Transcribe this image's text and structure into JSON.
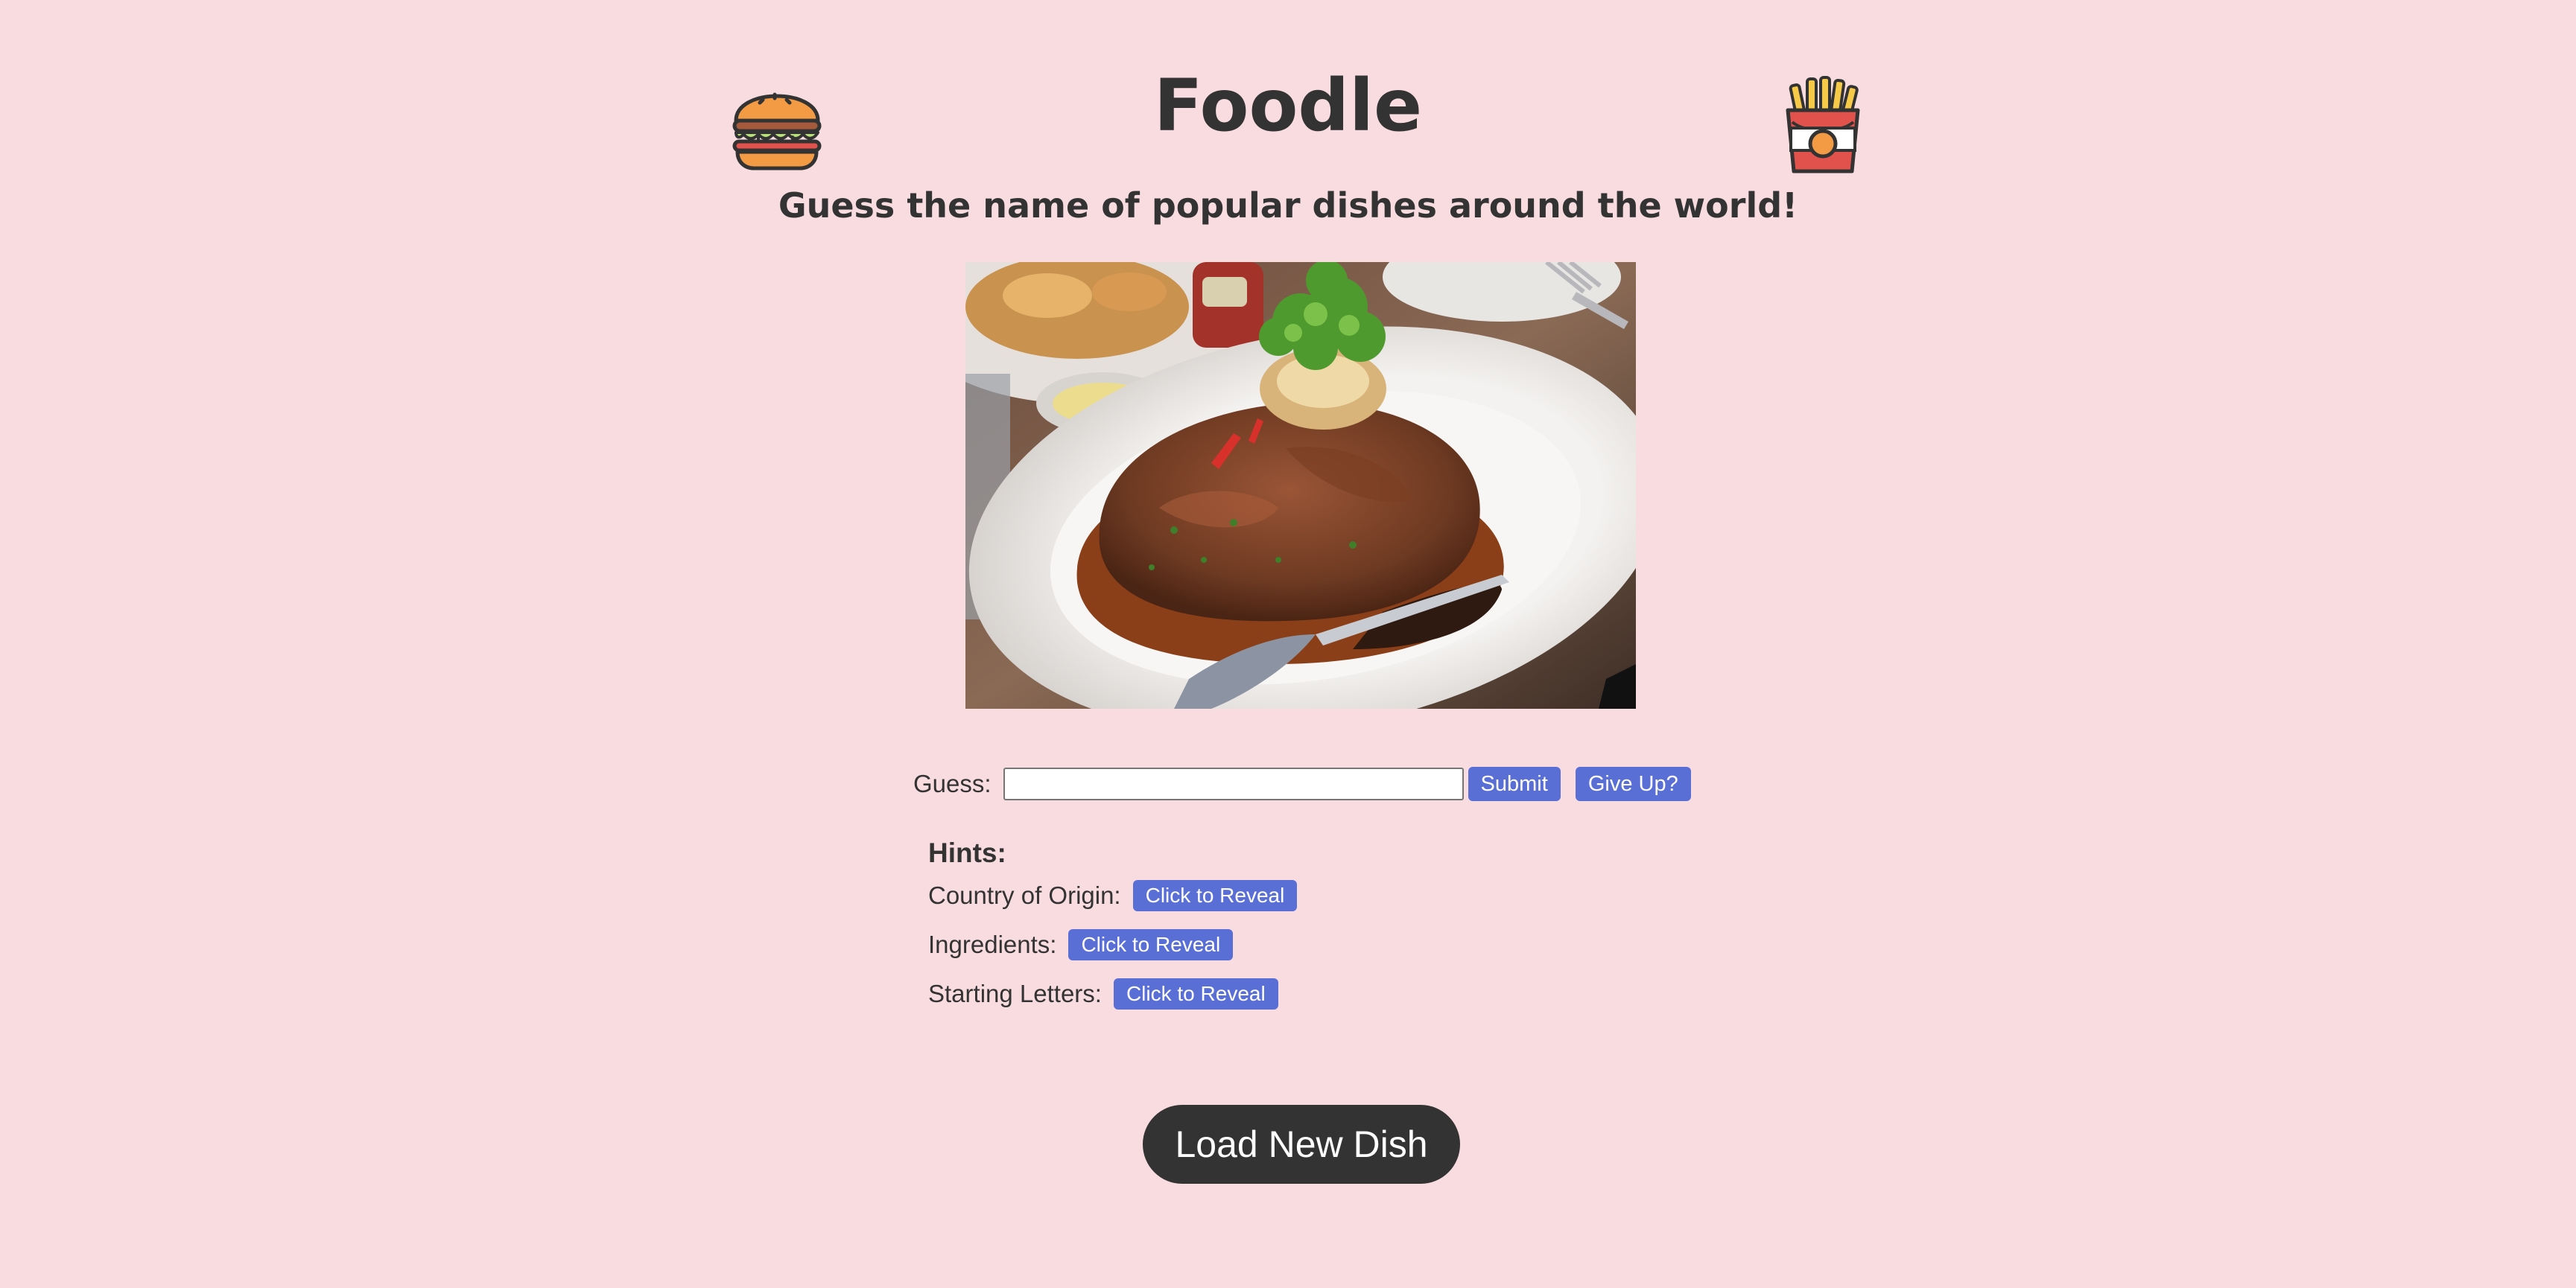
{
  "header": {
    "title": "Foodle",
    "subtitle": "Guess the name of popular dishes around the world!",
    "left_icon": "burger-icon",
    "right_icon": "fries-icon"
  },
  "dish": {
    "image": "photo of braised meat in rich sauce with parsley garnish on a white plate"
  },
  "guess": {
    "label": "Guess:",
    "value": "",
    "placeholder": "",
    "submit_label": "Submit",
    "give_up_label": "Give Up?"
  },
  "hints": {
    "heading": "Hints:",
    "items": [
      {
        "label": "Country of Origin:",
        "button": "Click to Reveal"
      },
      {
        "label": "Ingredients:",
        "button": "Click to Reveal"
      },
      {
        "label": "Starting Letters:",
        "button": "Click to Reveal"
      }
    ]
  },
  "load_new_label": "Load New Dish",
  "colors": {
    "background": "#f9dce0",
    "text": "#333333",
    "button": "#5a6fd6",
    "dark_button": "#333333"
  }
}
